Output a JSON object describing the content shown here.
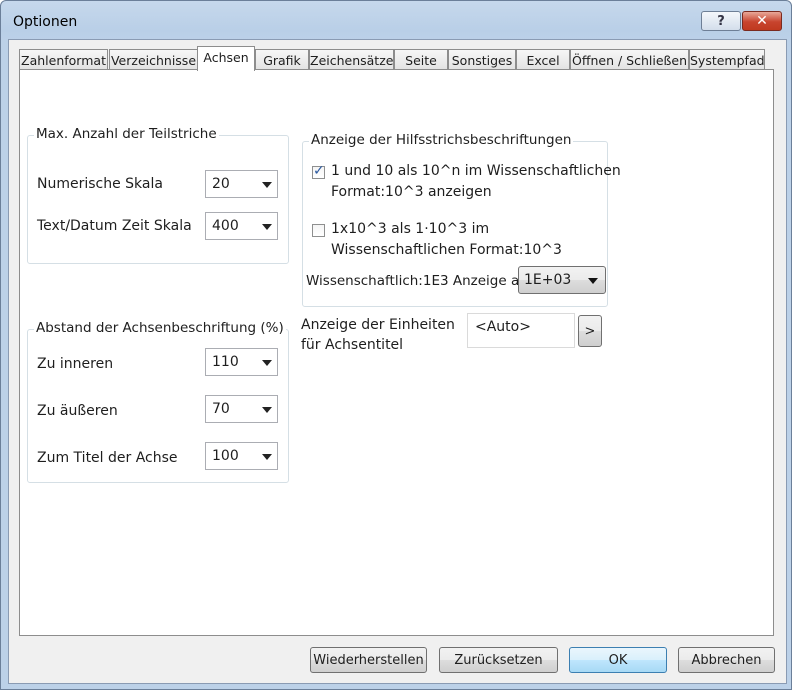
{
  "window": {
    "title": "Optionen",
    "help_glyph": "?",
    "close_glyph": "✕"
  },
  "tabs": [
    "Zahlenformat",
    "Verzeichnisse",
    "Achsen",
    "Grafik",
    "Zeichensätze",
    "Seite",
    "Sonstiges",
    "Excel",
    "Öffnen / Schließen",
    "Systempfad"
  ],
  "active_tab": "Achsen",
  "ticks_group": {
    "legend": "Max. Anzahl der Teilstriche",
    "numeric_label": "Numerische Skala",
    "numeric_value": "20",
    "text_label": "Text/Datum Zeit Skala",
    "text_value": "400"
  },
  "spacing_group": {
    "legend": "Abstand der Achsenbeschriftung (%)",
    "inner_label": "Zu inneren",
    "inner_value": "110",
    "outer_label": "Zu äußeren",
    "outer_value": "70",
    "title_label": "Zum Titel der Achse",
    "title_value": "100"
  },
  "gridlabel_group": {
    "legend": "Anzeige der Hilfsstrichsbeschriftungen",
    "check1_line1": "1 und 10 als 10^n im Wissenschaftlichen",
    "check1_line2": "Format:10^3 anzeigen",
    "check1_checked": true,
    "check2_line1": "1x10^3 als 1·10^3 im",
    "check2_line2": "Wissenschaftlichen Format:10^3",
    "check2_checked": false,
    "sci_label": "Wissenschaftlich:1E3 Anzeige als",
    "sci_value": "1E+03"
  },
  "units": {
    "label_line1": "Anzeige der Einheiten",
    "label_line2": "für Achsentitel",
    "value": "<Auto>",
    "button": ">"
  },
  "buttons": {
    "restore": "Wiederherstellen",
    "reset": "Zurücksetzen",
    "ok": "OK",
    "cancel": "Abbrechen"
  }
}
